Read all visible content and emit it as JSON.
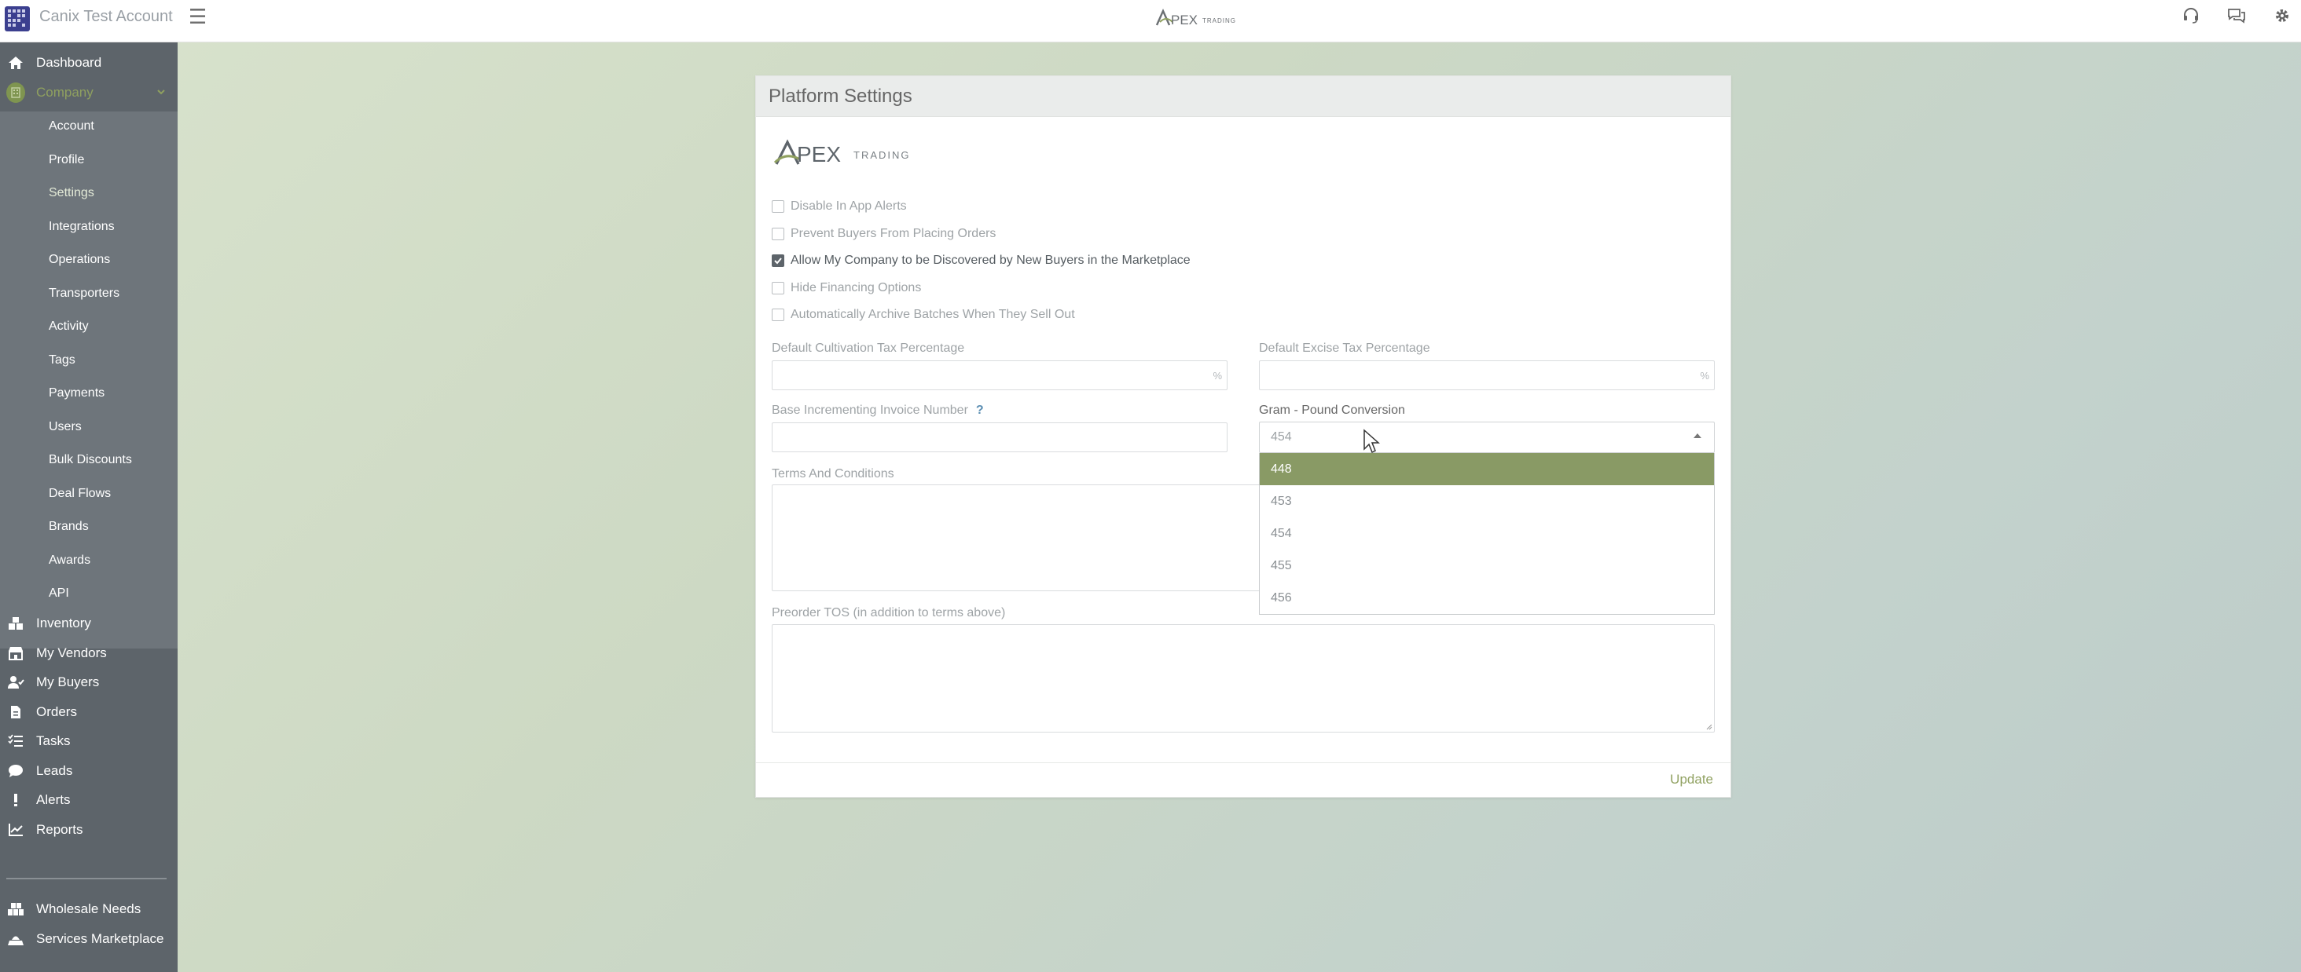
{
  "header": {
    "account_name": "Canix Test Account",
    "brand": "APEX TRADING",
    "icons": [
      "support-icon",
      "chat-icon",
      "gear-icon"
    ]
  },
  "sidebar": {
    "dashboard": "Dashboard",
    "company": "Company",
    "company_sub": [
      "Account",
      "Profile",
      "Settings",
      "Integrations",
      "Operations",
      "Transporters",
      "Activity",
      "Tags",
      "Payments",
      "Users",
      "Bulk Discounts",
      "Deal Flows",
      "Brands",
      "Awards",
      "API"
    ],
    "main": [
      "Inventory",
      "My Vendors",
      "My Buyers",
      "Orders",
      "Tasks",
      "Leads",
      "Alerts",
      "Reports"
    ],
    "bottom": [
      "Wholesale Needs",
      "Services Marketplace"
    ]
  },
  "panel": {
    "title": "Platform Settings",
    "logo_text": "TRADING",
    "checkboxes": [
      {
        "label": "Disable In App Alerts",
        "checked": false
      },
      {
        "label": "Prevent Buyers From Placing Orders",
        "checked": false
      },
      {
        "label": "Allow My Company to be Discovered by New Buyers in the Marketplace",
        "checked": true
      },
      {
        "label": "Hide Financing Options",
        "checked": false
      },
      {
        "label": "Automatically Archive Batches When They Sell Out",
        "checked": false
      }
    ],
    "cultivation_label": "Default Cultivation Tax Percentage",
    "excise_label": "Default Excise Tax Percentage",
    "percent_sign": "%",
    "invoice_label": "Base Incrementing Invoice Number",
    "help_mark": "?",
    "gram_label": "Gram - Pound Conversion",
    "gram_value": "454",
    "gram_options": [
      "448",
      "453",
      "454",
      "455",
      "456"
    ],
    "terms_label": "Terms And Conditions",
    "preorder_label": "Preorder TOS (in addition to terms above)",
    "update": "Update"
  }
}
